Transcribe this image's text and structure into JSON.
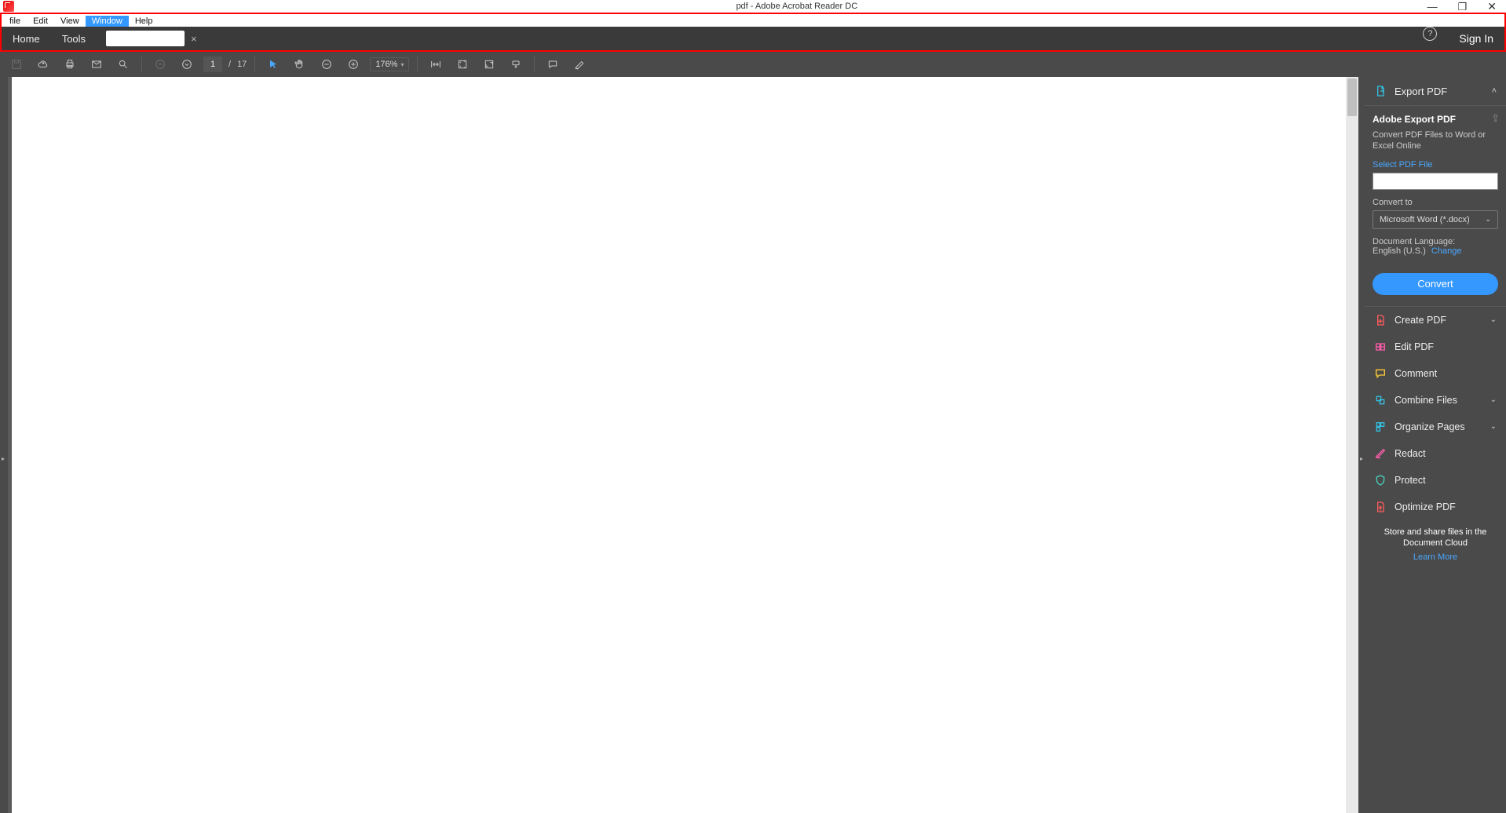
{
  "window": {
    "title": "pdf - Adobe Acrobat Reader DC"
  },
  "menubar": [
    "file",
    "Edit",
    "View",
    "Window",
    "Help"
  ],
  "menubar_highlight_index": 3,
  "tabbar": {
    "home": "Home",
    "tools": "Tools",
    "signin": "Sign In"
  },
  "toolbar": {
    "page_current": "1",
    "page_sep": "/",
    "page_total": "17",
    "zoom": "176%"
  },
  "right_panel": {
    "export": {
      "title": "Export PDF",
      "heading": "Adobe Export PDF",
      "desc": "Convert PDF Files to Word or Excel Online",
      "select_label": "Select PDF File",
      "convert_to_label": "Convert to",
      "convert_to_value": "Microsoft Word (*.docx)",
      "lang_label": "Document Language:",
      "lang_value": "English (U.S.)",
      "change": "Change",
      "convert_btn": "Convert"
    },
    "tools": [
      {
        "name": "Create PDF",
        "chev": true,
        "color": "#ff5c5c"
      },
      {
        "name": "Edit PDF",
        "chev": false,
        "color": "#ff5cad"
      },
      {
        "name": "Comment",
        "chev": false,
        "color": "#ffcc33"
      },
      {
        "name": "Combine Files",
        "chev": true,
        "color": "#33bfe0"
      },
      {
        "name": "Organize Pages",
        "chev": true,
        "color": "#33bfe0"
      },
      {
        "name": "Redact",
        "chev": false,
        "color": "#ff5cad"
      },
      {
        "name": "Protect",
        "chev": false,
        "color": "#4ad0c0"
      },
      {
        "name": "Optimize PDF",
        "chev": false,
        "color": "#ff5c5c"
      }
    ],
    "footer": "Store and share files in the Document Cloud",
    "learn_more": "Learn More"
  }
}
